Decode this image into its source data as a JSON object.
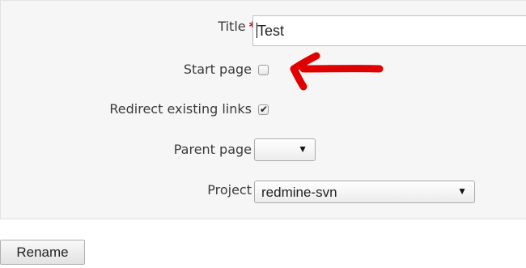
{
  "form": {
    "title_label": "Title",
    "required_marker": "*",
    "title_value": "Test",
    "start_page_label": "Start page",
    "start_page_checked": false,
    "redirect_label": "Redirect existing links",
    "redirect_checked": true,
    "redirect_checkmark": "✔",
    "parent_page_label": "Parent page",
    "parent_page_value": "",
    "project_label": "Project",
    "project_value": "redmine-svn",
    "dropdown_arrow": "▼"
  },
  "actions": {
    "rename_label": "Rename"
  },
  "annotation": {
    "color": "#e00000",
    "shape": "hand-drawn-arrow-pointing-left"
  }
}
